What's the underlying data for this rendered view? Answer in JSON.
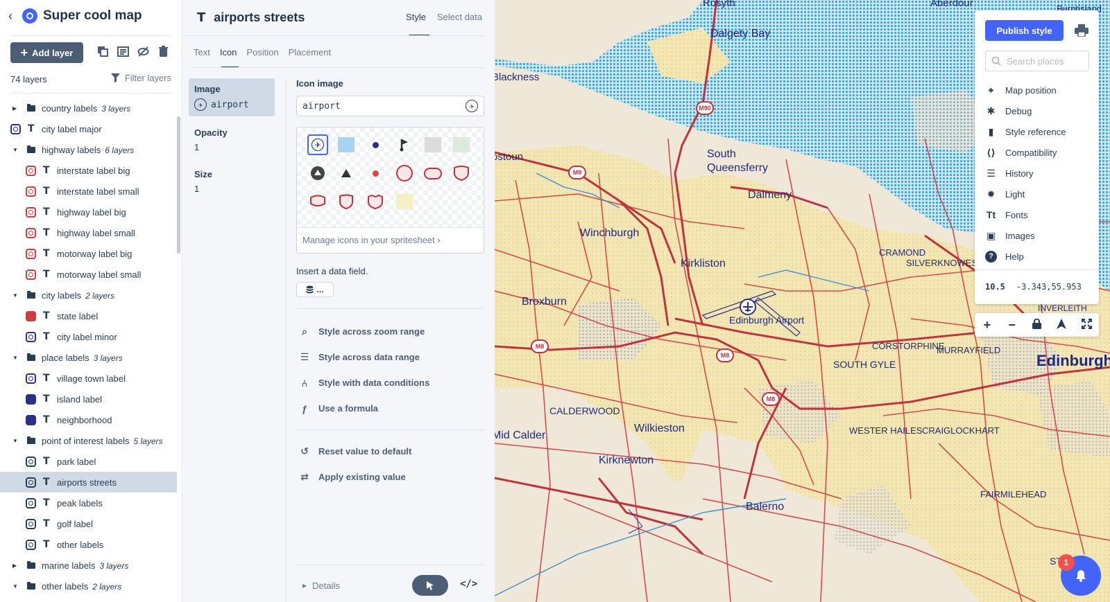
{
  "app": {
    "title": "Super cool map"
  },
  "sidebar": {
    "add_layer_label": "Add layer",
    "layers_count": "74 layers",
    "filter_label": "Filter layers",
    "layers": [
      {
        "type": "group",
        "name": "country labels",
        "count": "3 layers",
        "expanded": false
      },
      {
        "type": "layer",
        "name": "city label major",
        "badge": "blue-outline"
      },
      {
        "type": "group",
        "name": "highway labels",
        "count": "6 layers",
        "expanded": true
      },
      {
        "type": "layer",
        "name": "interstate label big",
        "badge": "red-outline",
        "indent": true
      },
      {
        "type": "layer",
        "name": "interstate label small",
        "badge": "red-outline",
        "indent": true
      },
      {
        "type": "layer",
        "name": "highway label big",
        "badge": "red-outline",
        "indent": true
      },
      {
        "type": "layer",
        "name": "highway label small",
        "badge": "red-outline",
        "indent": true
      },
      {
        "type": "layer",
        "name": "motorway label big",
        "badge": "red-outline",
        "indent": true
      },
      {
        "type": "layer",
        "name": "motorway label small",
        "badge": "red-outline",
        "indent": true
      },
      {
        "type": "group",
        "name": "city labels",
        "count": "2 layers",
        "expanded": true
      },
      {
        "type": "layer",
        "name": "state label",
        "badge": "red-solid",
        "indent": true
      },
      {
        "type": "layer",
        "name": "city label minor",
        "badge": "blue-outline",
        "indent": true
      },
      {
        "type": "group",
        "name": "place labels",
        "count": "3 layers",
        "expanded": true
      },
      {
        "type": "layer",
        "name": "village town label",
        "badge": "blue-outline",
        "indent": true
      },
      {
        "type": "layer",
        "name": "island label",
        "badge": "blue-solid",
        "indent": true
      },
      {
        "type": "layer",
        "name": "neighborhood",
        "badge": "blue-solid",
        "indent": true
      },
      {
        "type": "group",
        "name": "point of interest labels",
        "count": "5 layers",
        "expanded": true
      },
      {
        "type": "layer",
        "name": "park label",
        "badge": "dark-outline",
        "indent": true
      },
      {
        "type": "layer",
        "name": "airports streets",
        "badge": "dark-outline",
        "indent": true,
        "selected": true
      },
      {
        "type": "layer",
        "name": "peak labels",
        "badge": "dark-outline",
        "indent": true
      },
      {
        "type": "layer",
        "name": "golf label",
        "badge": "dark-outline",
        "indent": true
      },
      {
        "type": "layer",
        "name": "other labels",
        "badge": "dark-outline",
        "indent": true
      },
      {
        "type": "group",
        "name": "marine labels",
        "count": "3 layers",
        "expanded": false
      },
      {
        "type": "group",
        "name": "other labels",
        "count": "2 layers",
        "expanded": true
      }
    ]
  },
  "panel": {
    "layer_title": "airports streets",
    "tabs": {
      "style": "Style",
      "select_data": "Select data"
    },
    "sub_tabs": [
      "Text",
      "Icon",
      "Position",
      "Placement"
    ],
    "properties": [
      {
        "label": "Image",
        "value": "airport",
        "active": true
      },
      {
        "label": "Opacity",
        "value": "1"
      },
      {
        "label": "Size",
        "value": "1"
      }
    ],
    "icon_image_label": "Icon image",
    "icon_image_value": "airport",
    "manage_icons": "Manage icons in your spritesheet",
    "insert_field": "Insert a data field.",
    "data_field_btn": "...",
    "actions": [
      "Style across zoom range",
      "Style across data range",
      "Style with data conditions",
      "Use a formula"
    ],
    "actions2": [
      "Reset value to default",
      "Apply existing value"
    ],
    "details": "Details",
    "code_label": "</>"
  },
  "toolbar": {
    "publish": "Publish style",
    "search_placeholder": "Search places",
    "menu": [
      "Map position",
      "Debug",
      "Style reference",
      "Compatibility",
      "History",
      "Light",
      "Fonts",
      "Images",
      "Help"
    ],
    "zoom": "10.5",
    "coords": "-3.343,55.953"
  },
  "map": {
    "labels": [
      "Rosyth",
      "Aberdour",
      "Burntisland",
      "Dalgety Bay",
      "Blackness",
      "ostoun",
      "South",
      "Queensferry",
      "Dalmeny",
      "Winchburgh",
      "CRAMOND",
      "SILVERKNOWES",
      "Kirkliston",
      "INVERLEITH",
      "Broxburn",
      "Edinburgh Airport",
      "CORSTORPHINE",
      "MURRAYFIELD",
      "SOUTH GYLE",
      "Edinburgh",
      "CALDERWOOD",
      "Wilkieston",
      "WESTER HAILES",
      "CRAIGLOCKHART",
      "Mid Calder",
      "Kirknewton",
      "FAIRMILEHEAD",
      "Balerno",
      "ST"
    ],
    "shields": [
      "M90",
      "M9",
      "M8",
      "M8",
      "M8"
    ]
  },
  "notifications": {
    "count": "1"
  },
  "colors": {
    "accent": "#4264fb",
    "road": "#d23a3f",
    "water": "#3aa7d4",
    "land": "#efe8d8",
    "urban": "#f3e3a2"
  }
}
